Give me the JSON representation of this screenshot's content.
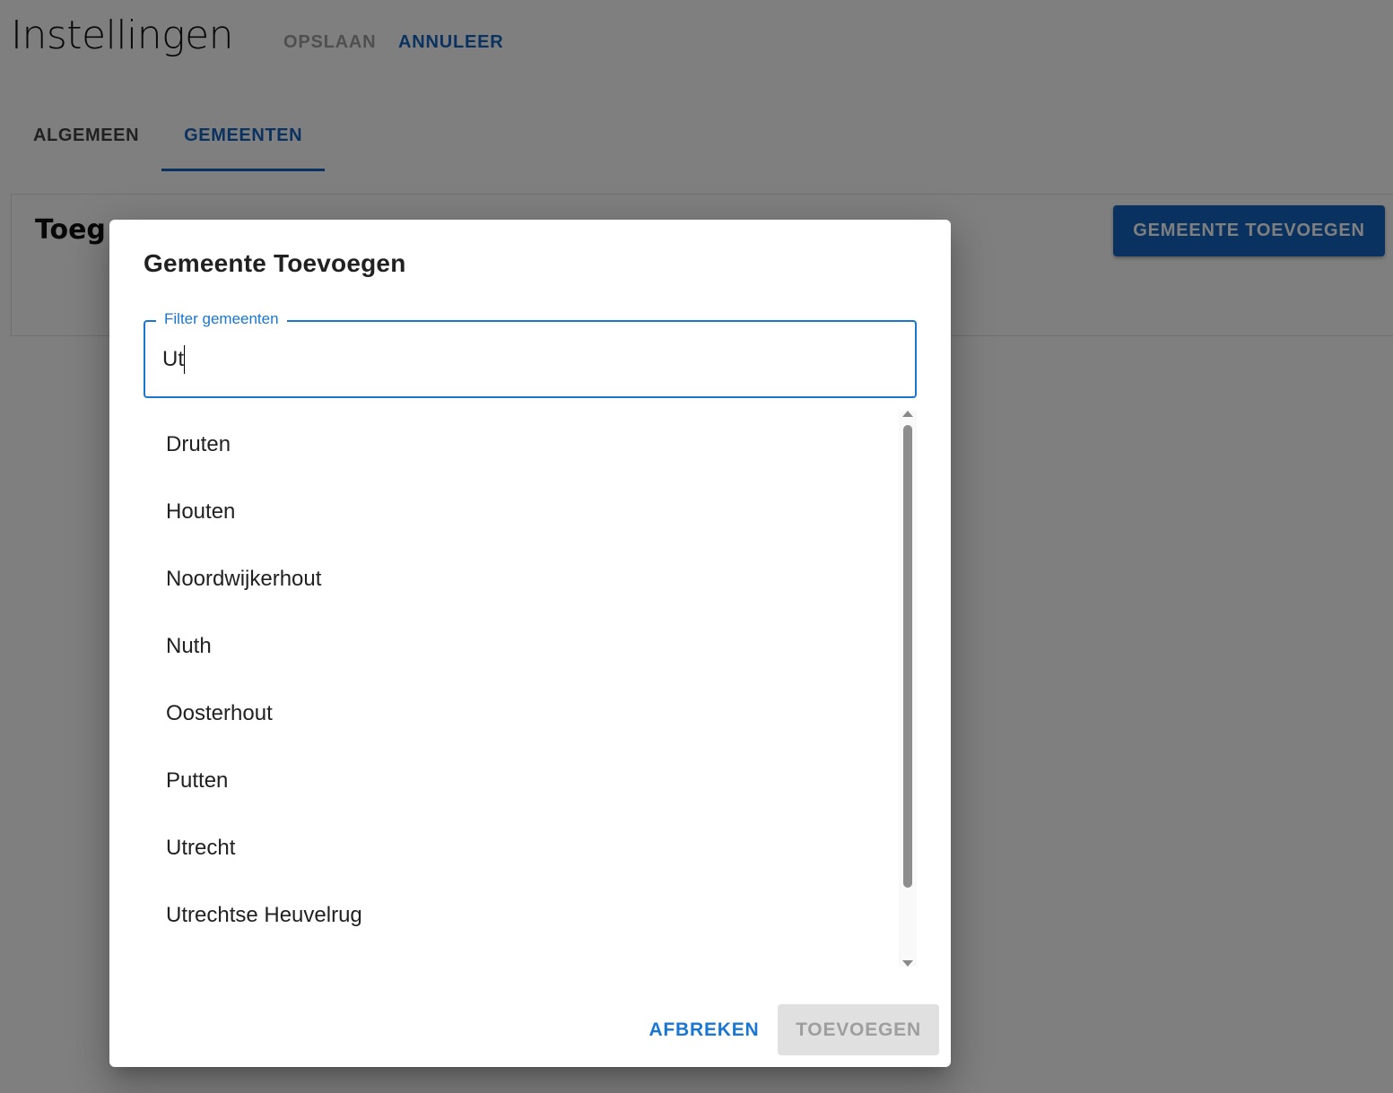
{
  "header": {
    "title": "Instellingen",
    "save_label": "OPSLAAN",
    "cancel_label": "ANNULEER"
  },
  "tabs": [
    {
      "label": "ALGEMEEN",
      "active": false
    },
    {
      "label": "GEMEENTEN",
      "active": true
    }
  ],
  "card": {
    "title_visible": "Toeg",
    "add_button_label": "GEMEENTE TOEVOEGEN"
  },
  "dialog": {
    "title": "Gemeente Toevoegen",
    "filter": {
      "label": "Filter gemeenten",
      "value": "Ut"
    },
    "items": [
      "Druten",
      "Houten",
      "Noordwijkerhout",
      "Nuth",
      "Oosterhout",
      "Putten",
      "Utrecht",
      "Utrechtse Heuvelrug"
    ],
    "cancel_label": "AFBREKEN",
    "add_label": "TOEVOEGEN"
  },
  "colors": {
    "primary": "#1565c0",
    "primary_light": "#1976d2",
    "disabled_bg": "#e0e0e0",
    "disabled_text": "#9e9e9e"
  }
}
